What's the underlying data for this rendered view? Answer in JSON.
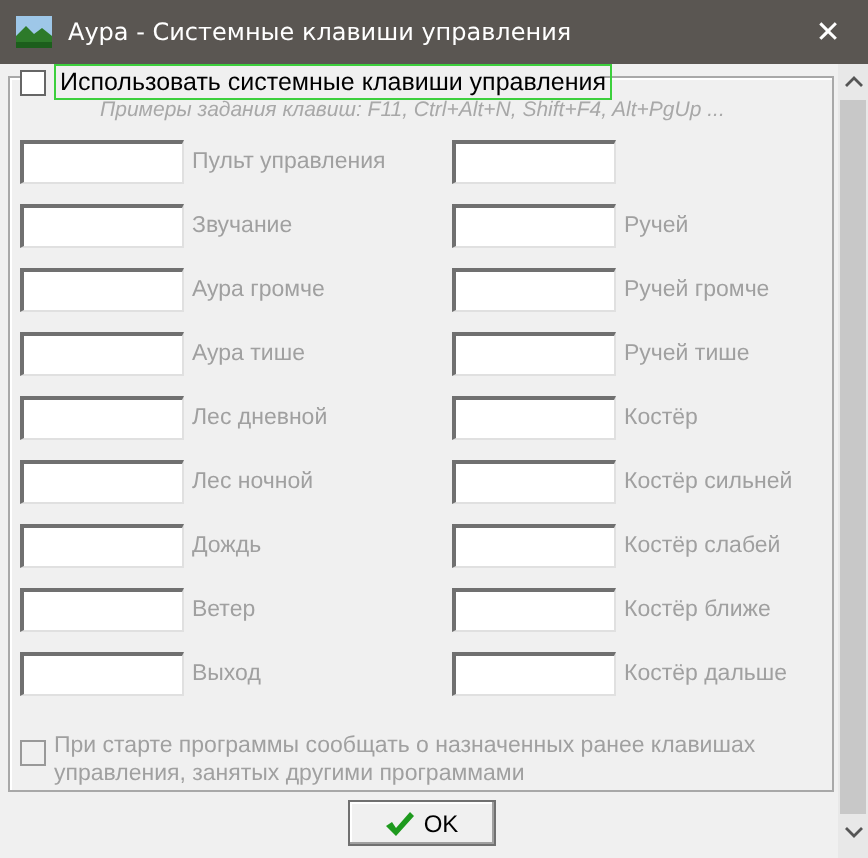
{
  "window": {
    "title": "Аура - Системные клавиши управления",
    "close": "✕"
  },
  "use_keys": {
    "label": "Использовать системные клавиши управления",
    "checked": false,
    "focused": true
  },
  "hint": "Примеры задания клавиш: F11, Ctrl+Alt+N, Shift+F4, Alt+PgUp ...",
  "rows": [
    {
      "left": "Пульт управления",
      "right": null
    },
    {
      "left": "Звучание",
      "right": "Ручей"
    },
    {
      "left": "Аура громче",
      "right": "Ручей громче"
    },
    {
      "left": "Аура тише",
      "right": "Ручей тише"
    },
    {
      "left": "Лес дневной",
      "right": "Костёр"
    },
    {
      "left": "Лес ночной",
      "right": "Костёр сильней"
    },
    {
      "left": "Дождь",
      "right": "Костёр слабей"
    },
    {
      "left": "Ветер",
      "right": "Костёр ближе"
    },
    {
      "left": "Выход",
      "right": "Костёр дальше"
    }
  ],
  "startup_check": {
    "label": "При старте программы сообщать о назначенных ранее клавишах управления, занятых другими программами",
    "checked": false,
    "disabled": true
  },
  "ok_button": "OK"
}
